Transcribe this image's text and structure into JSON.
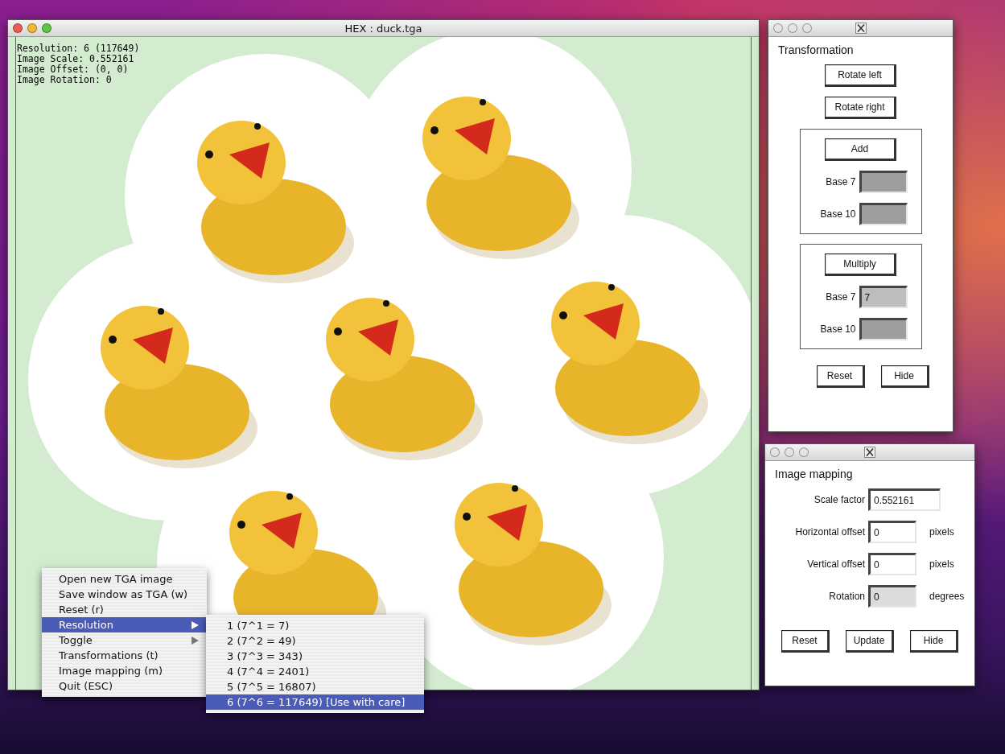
{
  "main_window": {
    "title": "HEX : duck.tga",
    "active": true,
    "info_lines": [
      "Resolution: 6 (117649)",
      "Image Scale: 0.552161",
      "Image Offset: (0, 0)",
      "Image Rotation: 0"
    ]
  },
  "context_menu": {
    "items": [
      {
        "label": "Open new TGA image",
        "selected": false,
        "has_submenu": false
      },
      {
        "label": "Save window as TGA (w)",
        "selected": false,
        "has_submenu": false
      },
      {
        "label": "Reset (r)",
        "selected": false,
        "has_submenu": false
      },
      {
        "label": "Resolution",
        "selected": true,
        "has_submenu": true
      },
      {
        "label": "Toggle",
        "selected": false,
        "has_submenu": true
      },
      {
        "label": "Transformations (t)",
        "selected": false,
        "has_submenu": false
      },
      {
        "label": "Image mapping (m)",
        "selected": false,
        "has_submenu": false
      },
      {
        "label": "Quit (ESC)",
        "selected": false,
        "has_submenu": false
      }
    ]
  },
  "submenu": {
    "items": [
      {
        "label": "1 (7^1 = 7)",
        "selected": false
      },
      {
        "label": "2 (7^2 = 49)",
        "selected": false
      },
      {
        "label": "3 (7^3 = 343)",
        "selected": false
      },
      {
        "label": "4 (7^4 = 2401)",
        "selected": false
      },
      {
        "label": "5 (7^5 = 16807)",
        "selected": false
      },
      {
        "label": "6 (7^6 = 117649) [Use with care]",
        "selected": true
      }
    ]
  },
  "transformation_window": {
    "active": false,
    "heading": "Transformation",
    "buttons": [
      "Rotate left",
      "Rotate right"
    ],
    "groups": [
      {
        "button": "Add",
        "fields": [
          {
            "label": "Base 7",
            "focused": false
          },
          {
            "label": "Base 10",
            "focused": false
          }
        ]
      },
      {
        "button": "Multiply",
        "fields": [
          {
            "label": "Base 7",
            "value": "7",
            "focused": true
          },
          {
            "label": "Base 10",
            "focused": false
          }
        ]
      }
    ],
    "footer_buttons": [
      "Reset",
      "Hide"
    ]
  },
  "image_mapping_window": {
    "active": false,
    "heading": "Image mapping",
    "fields": [
      {
        "label": "Scale factor",
        "value": "0.552161",
        "focused": false,
        "wide": true
      },
      {
        "label": "Horizontal offset",
        "value": "0",
        "unit": "pixels",
        "focused": false,
        "wide": false
      },
      {
        "label": "Vertical offset",
        "value": "0",
        "unit": "pixels",
        "focused": false,
        "wide": false
      },
      {
        "label": "Rotation",
        "value": "0",
        "unit": "degrees",
        "focused": true,
        "wide": false
      }
    ],
    "footer_buttons": [
      "Reset",
      "Update",
      "Hide"
    ]
  }
}
